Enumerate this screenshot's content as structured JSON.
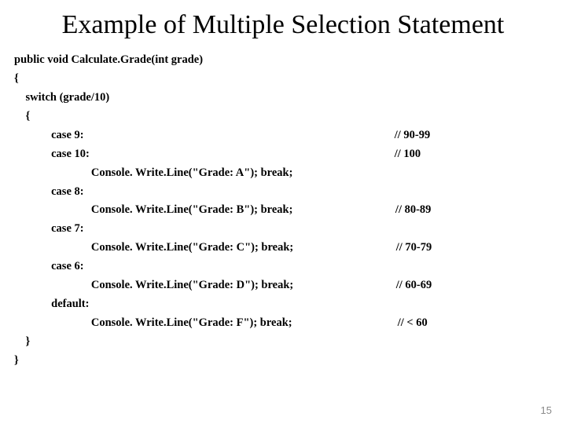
{
  "title": "Example of Multiple Selection Statement",
  "code": {
    "l1": "public void Calculate.Grade(int grade)",
    "l2": "{",
    "l3": "    switch (grade/10)",
    "l4": "    {",
    "l5": "             case 9:                                                                                                             // 90-99",
    "l6": "             case 10:                                                                                                           // 100",
    "l7": "                           Console. Write.Line(\"Grade: A\"); break;",
    "l8": "             case 8:",
    "l9": "                           Console. Write.Line(\"Grade: B\"); break;                                    // 80-89",
    "l10": "             case 7:",
    "l11": "                           Console. Write.Line(\"Grade: C\"); break;                                    // 70-79",
    "l12": "             case 6:",
    "l13": "                           Console. Write.Line(\"Grade: D\"); break;                                    // 60-69",
    "l14": "             default:",
    "l15": "                           Console. Write.Line(\"Grade: F\"); break;                                     // < 60",
    "l16": "    }",
    "l17": "}"
  },
  "pagenum": "15"
}
